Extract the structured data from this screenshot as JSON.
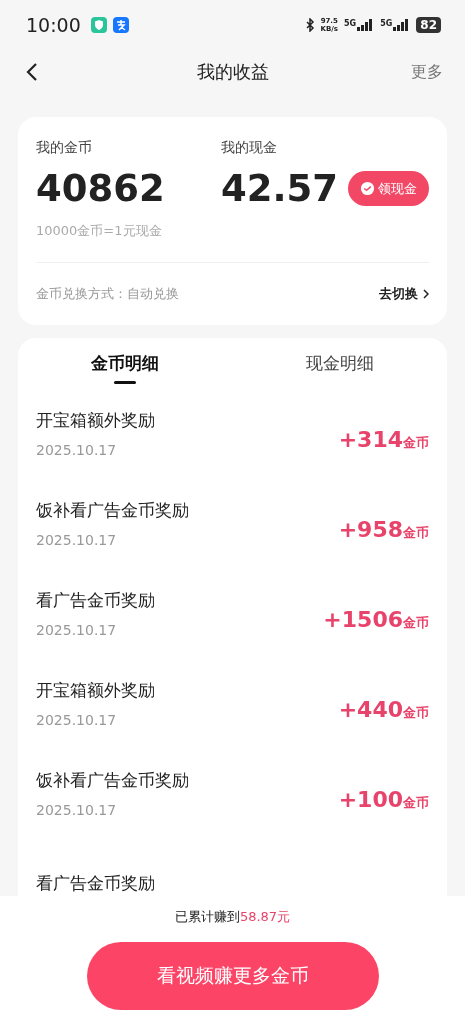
{
  "status_bar": {
    "time": "10:00",
    "speed": "97.5",
    "speed_unit": "KB/s",
    "network_1": "5G",
    "network_2": "5G",
    "battery": "82"
  },
  "header": {
    "title": "我的收益",
    "more": "更多"
  },
  "summary": {
    "coins_label": "我的金币",
    "coins": "40862",
    "cash_label": "我的现金",
    "cash": "42.57",
    "withdraw_button": "领现金",
    "rate": "10000金币=1元现金",
    "exchange_mode": "金币兑换方式：自动兑换",
    "switch_link": "去切换"
  },
  "tabs": [
    {
      "label": "金币明细",
      "selected": true
    },
    {
      "label": "现金明细",
      "selected": false
    }
  ],
  "records": [
    {
      "title": "开宝箱额外奖励",
      "date": "2025.10.17",
      "amount": "+314",
      "unit": "金币"
    },
    {
      "title": "饭补看广告金币奖励",
      "date": "2025.10.17",
      "amount": "+958",
      "unit": "金币"
    },
    {
      "title": "看广告金币奖励",
      "date": "2025.10.17",
      "amount": "+1506",
      "unit": "金币"
    },
    {
      "title": "开宝箱额外奖励",
      "date": "2025.10.17",
      "amount": "+440",
      "unit": "金币"
    },
    {
      "title": "饭补看广告金币奖励",
      "date": "2025.10.17",
      "amount": "+100",
      "unit": "金币"
    },
    {
      "title": "看广告金币奖励"
    }
  ],
  "footer": {
    "earned_prefix": "已累计赚到",
    "earned_amount": "58.87元",
    "cta_button": "看视频赚更多金币"
  }
}
